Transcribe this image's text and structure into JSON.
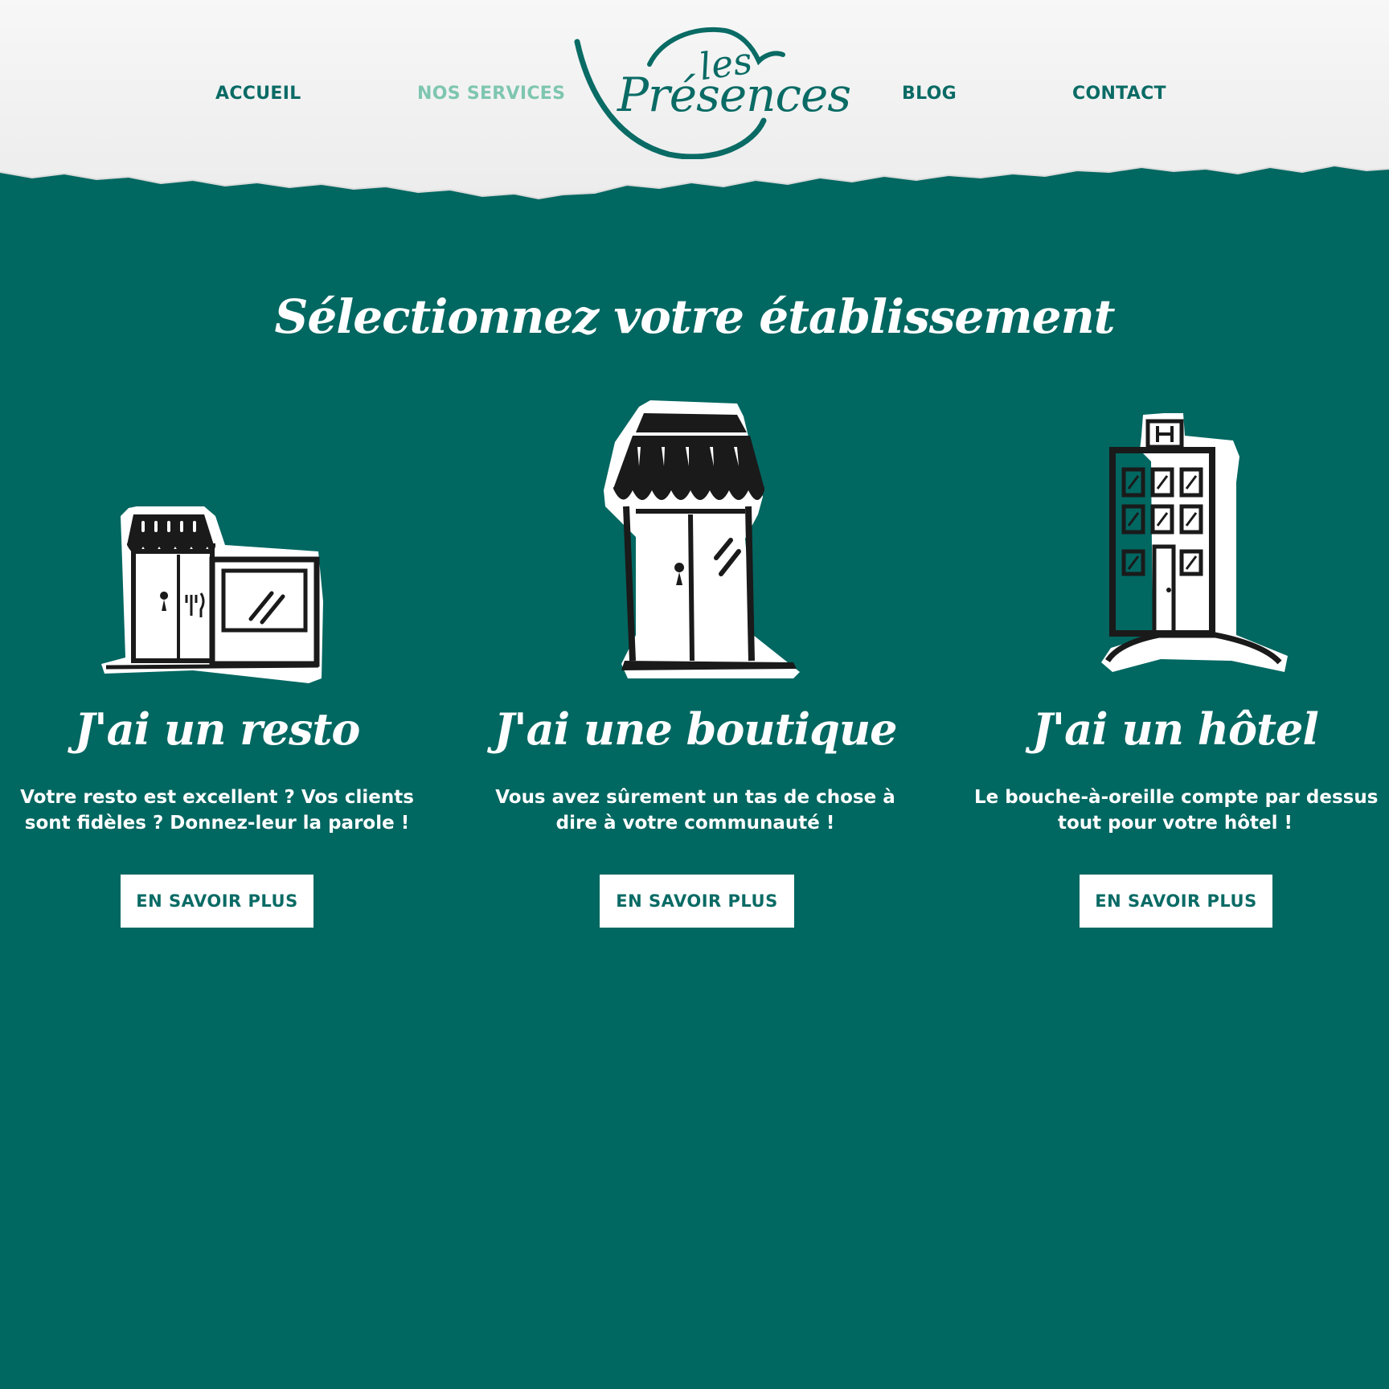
{
  "nav": {
    "items": [
      {
        "label": "ACCUEIL"
      },
      {
        "label": "NOS SERVICES"
      },
      {
        "label": "BLOG"
      },
      {
        "label": "CONTACT"
      }
    ]
  },
  "logo": {
    "small": "les",
    "name": "Présences"
  },
  "main": {
    "title": "Sélectionnez votre établissement",
    "cards": [
      {
        "title": "J'ai un resto",
        "description": [
          "Votre resto est excellent ? Vos clients",
          "sont fidèles ? Donnez-leur la parole !"
        ],
        "button": "EN SAVOIR PLUS",
        "icon": "restaurant-building-icon"
      },
      {
        "title": "J'ai une boutique",
        "description": [
          "Vous avez sûrement un tas de chose à",
          "dire à votre communauté !"
        ],
        "button": "EN SAVOIR PLUS",
        "icon": "shop-building-icon"
      },
      {
        "title": "J'ai un hôtel",
        "description": [
          "Le bouche-à-oreille compte par dessus",
          "tout pour votre hôtel !"
        ],
        "button": "EN SAVOIR PLUS",
        "icon": "hotel-building-icon"
      }
    ]
  },
  "colors": {
    "teal": "#016761",
    "header": "#f4f4f4",
    "nav": "#0a6b65",
    "nav_active": "#7ec6b0",
    "white": "#ffffff"
  }
}
